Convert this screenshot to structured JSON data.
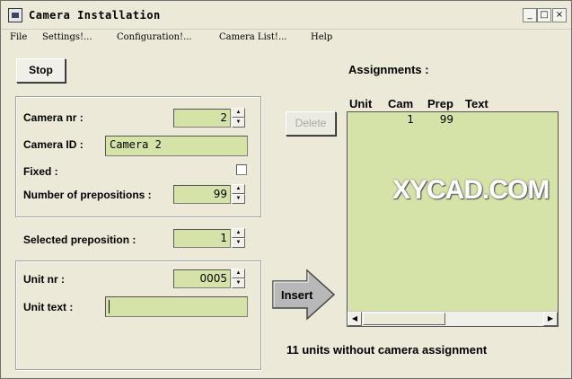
{
  "window": {
    "title": "Camera Installation"
  },
  "title_buttons": {
    "minimize": "_",
    "maximize": "□",
    "close": "×"
  },
  "menu": [
    "File",
    "Settings!...",
    "Configuration!...",
    "Camera List!...",
    "Help"
  ],
  "buttons": {
    "stop": "Stop",
    "delete": "Delete",
    "insert": "Insert"
  },
  "camera": {
    "nr_label": "Camera nr :",
    "nr_value": "2",
    "id_label": "Camera ID :",
    "id_value": "Camera 2",
    "fixed_label": "Fixed :",
    "fixed_checked": false,
    "prepositions_label": "Number of prepositions :",
    "prepositions_value": "99"
  },
  "selected_preposition": {
    "label": "Selected preposition :",
    "value": "1"
  },
  "unit": {
    "nr_label": "Unit nr :",
    "nr_value": "0005",
    "text_label": "Unit text :",
    "text_value": ""
  },
  "assignments": {
    "title": "Assignments :",
    "columns": [
      "Unit",
      "Cam",
      "Prep",
      "Text"
    ],
    "rows": [
      {
        "unit": "",
        "cam": "1",
        "prep": "99",
        "text": ""
      }
    ]
  },
  "status": "11  units without camera assignment",
  "watermark": "XYCAD.COM",
  "icons": {
    "app": "camera-app-icon",
    "spin_up": "spin-up-arrow-icon",
    "spin_down": "spin-down-arrow-icon",
    "scroll_left": "scroll-left-arrow-icon",
    "scroll_right": "scroll-right-arrow-icon",
    "insert_arrow": "right-arrow-icon"
  },
  "colors": {
    "field_bg": "#d6e3a8",
    "window_bg": "#ece9d8"
  }
}
